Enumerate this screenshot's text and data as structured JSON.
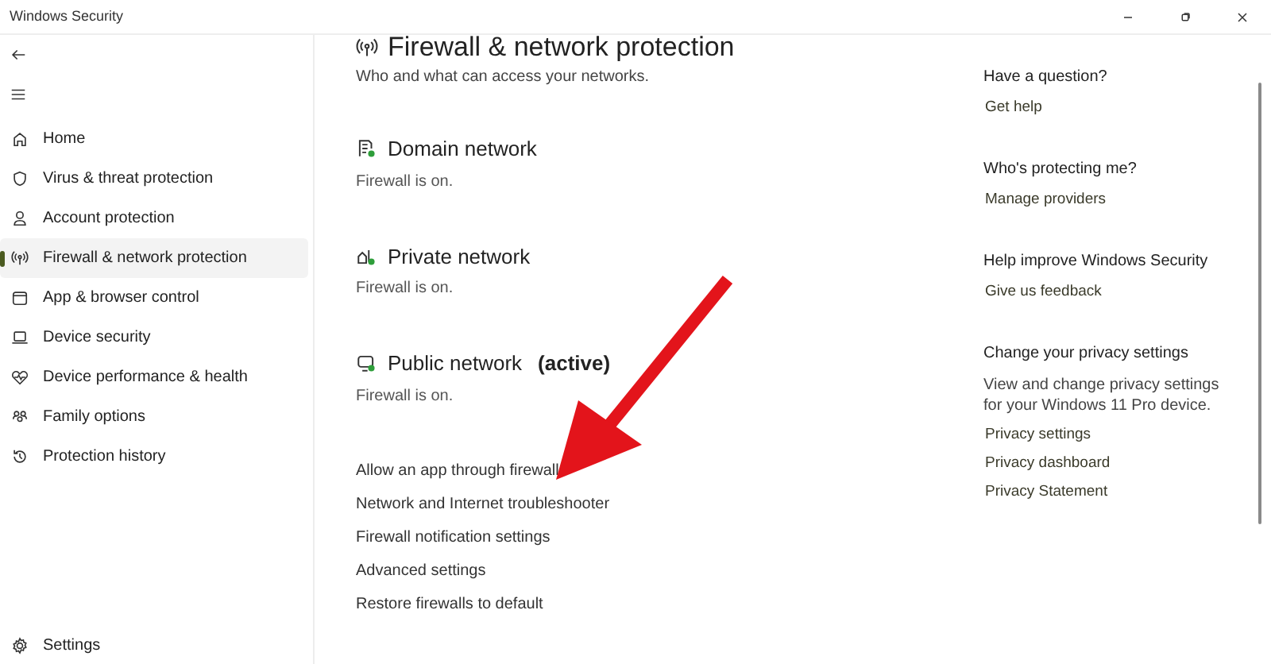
{
  "window": {
    "title": "Windows Security"
  },
  "sidebar": {
    "items": [
      {
        "label": "Home",
        "selected": false
      },
      {
        "label": "Virus & threat protection",
        "selected": false
      },
      {
        "label": "Account protection",
        "selected": false
      },
      {
        "label": "Firewall & network protection",
        "selected": true
      },
      {
        "label": "App & browser control",
        "selected": false
      },
      {
        "label": "Device security",
        "selected": false
      },
      {
        "label": "Device performance & health",
        "selected": false
      },
      {
        "label": "Family options",
        "selected": false
      },
      {
        "label": "Protection history",
        "selected": false
      }
    ],
    "settings": "Settings"
  },
  "page": {
    "title": "Firewall & network protection",
    "subtitle": "Who and what can access your networks.",
    "networks": [
      {
        "name": "Domain network",
        "status": "Firewall is on."
      },
      {
        "name": "Private network",
        "status": "Firewall is on."
      },
      {
        "name": "Public network",
        "active_label": "(active)",
        "status": "Firewall is on."
      }
    ],
    "links": [
      "Allow an app through firewall",
      "Network and Internet troubleshooter",
      "Firewall notification settings",
      "Advanced settings",
      "Restore firewalls to default"
    ]
  },
  "side_panel": [
    {
      "heading": "Have a question?",
      "links": [
        "Get help"
      ]
    },
    {
      "heading": "Who's protecting me?",
      "links": [
        "Manage providers"
      ]
    },
    {
      "heading": "Help improve Windows Security",
      "links": [
        "Give us feedback"
      ]
    },
    {
      "heading": "Change your privacy settings",
      "text": "View and change privacy settings for your Windows 11 Pro device.",
      "links": [
        "Privacy settings",
        "Privacy dashboard",
        "Privacy Statement"
      ]
    }
  ]
}
